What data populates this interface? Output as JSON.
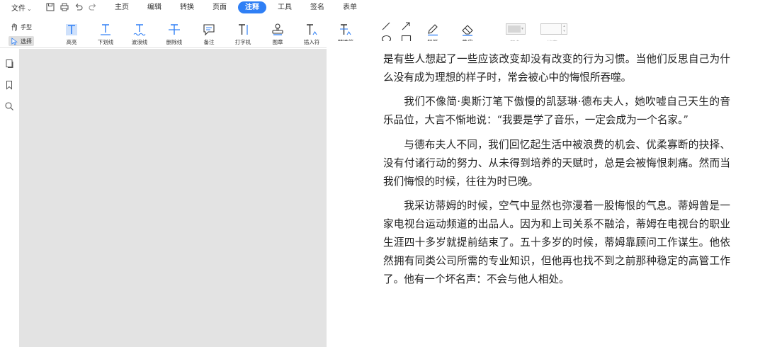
{
  "menu": {
    "file_label": "文件",
    "tabs": [
      {
        "label": "主页",
        "active": false
      },
      {
        "label": "编辑",
        "active": false
      },
      {
        "label": "转换",
        "active": false
      },
      {
        "label": "页面",
        "active": false
      },
      {
        "label": "注释",
        "active": true
      },
      {
        "label": "工具",
        "active": false
      },
      {
        "label": "签名",
        "active": false
      },
      {
        "label": "表单",
        "active": false
      }
    ],
    "accent": "#2f7ff5"
  },
  "ribbon": {
    "hand_label": "手型",
    "select_label": "选择",
    "tools": [
      {
        "label": "高亮",
        "icon": "highlight-icon"
      },
      {
        "label": "下划线",
        "icon": "underline-icon"
      },
      {
        "label": "波浪线",
        "icon": "squiggly-icon"
      },
      {
        "label": "删除线",
        "icon": "strikethrough-icon"
      },
      {
        "label": "备注",
        "icon": "note-icon"
      },
      {
        "label": "打字机",
        "icon": "typewriter-icon"
      },
      {
        "label": "图章",
        "icon": "stamp-icon"
      },
      {
        "label": "插入符",
        "icon": "insert-caret-icon"
      },
      {
        "label": "替换符",
        "icon": "replace-caret-icon"
      }
    ],
    "pencil_label": "铅笔",
    "eraser_label": "橡皮",
    "color_label": "颜色",
    "line_width_label": "线宽"
  },
  "document": {
    "paragraphs": [
      "谓五花八门、包罗万象，但是最深刻的答案（活跃一下气氛，权且这么说），是有些人想起了一些应该改变却没有改变的行为习惯。当他们反思自己为什么没有成为理想的样子时，常会被心中的悔恨所吞噬。",
      "我们不像简·奥斯汀笔下傲慢的凯瑟琳·德布夫人，她吹嘘自己天生的音乐品位，大言不惭地说：“我要是学了音乐，一定会成为一个名家。”",
      "与德布夫人不同，我们回忆起生活中被浪费的机会、优柔寡断的抉择、没有付诸行动的努力、从未得到培养的天赋时，总是会被悔恨刺痛。然而当我们悔恨的时候，往往为时已晚。",
      "我采访蒂姆的时候，空气中显然也弥漫着一股悔恨的气息。蒂姆曾是一家电视台运动频道的出品人。因为和上司关系不融洽，蒂姆在电视台的职业生涯四十多岁就提前结束了。五十多岁的时候，蒂姆靠顾问工作谋生。他依然拥有同类公司所需的专业知识，但他再也找不到之前那种稳定的高管工作了。他有一个坏名声：不会与他人相处。"
    ]
  }
}
